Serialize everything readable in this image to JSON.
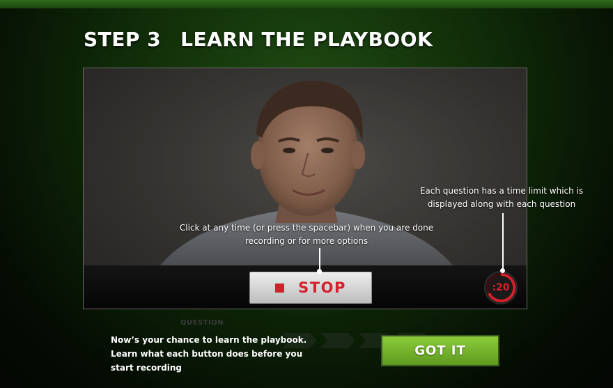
{
  "header": {
    "step_label": "STEP 3",
    "title": "LEARN THE PLAYBOOK"
  },
  "tips": {
    "stop_tip": "Click at any time (or press the spacebar) when you are done recording or for more options",
    "timer_tip": "Each question has a time limit which is displayed along with each question"
  },
  "controls": {
    "stop_label": "STOP",
    "timer_value": ":20"
  },
  "footer": {
    "question_label": "QUESTION",
    "intro_text": "Now’s your chance to learn the playbook. Learn what each button does before you start recording",
    "got_it_label": "GOT IT"
  },
  "colors": {
    "accent_red": "#d3202a",
    "accent_green": "#79b52e",
    "background": "#0f2a08"
  }
}
